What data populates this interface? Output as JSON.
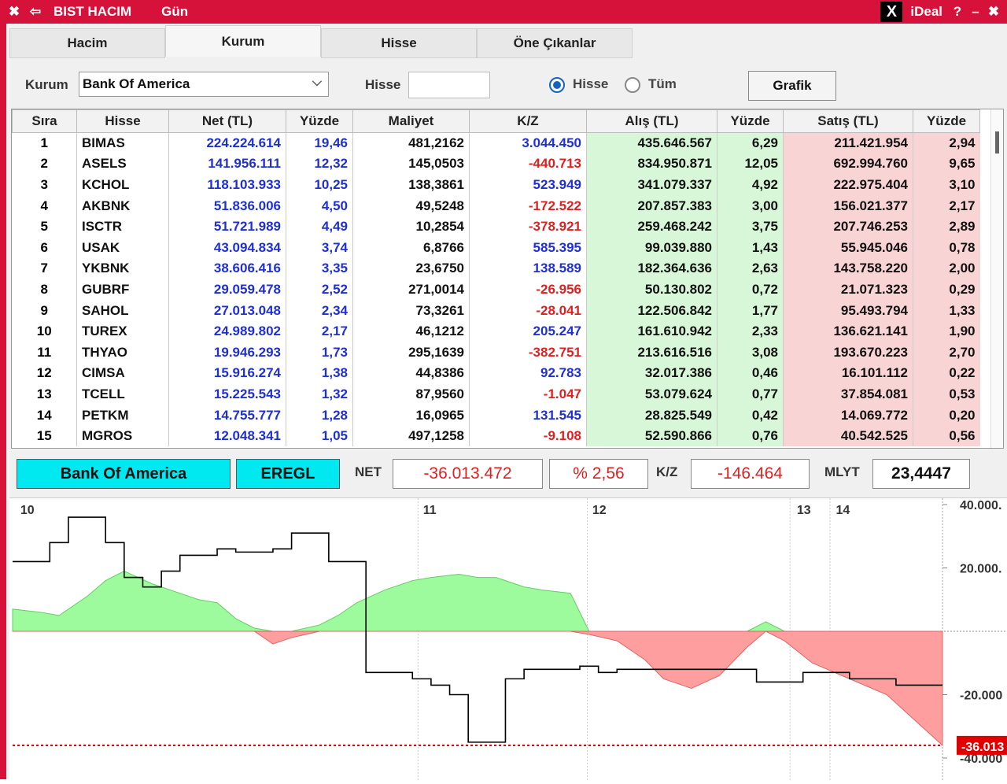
{
  "titlebar": {
    "close_symbol": "✖",
    "back_symbol": "⇦",
    "title": "BIST HACIM",
    "period": "Gün",
    "x_logo": "X",
    "brand": "iDeal",
    "help": "?",
    "minimize": "–",
    "close_right": "✖"
  },
  "tabs": [
    {
      "label": "Hacim"
    },
    {
      "label": "Kurum"
    },
    {
      "label": "Hisse"
    },
    {
      "label": "Öne Çıkanlar"
    }
  ],
  "filters": {
    "kurum_label": "Kurum",
    "kurum_value": "Bank Of America",
    "hisse_label": "Hisse",
    "hisse_value": "",
    "radio_hisse": "Hisse",
    "radio_tum": "Tüm",
    "grafik_button": "Grafik"
  },
  "table": {
    "headers": [
      "Sıra",
      "Hisse",
      "Net (TL)",
      "Yüzde",
      "Maliyet",
      "K/Z",
      "Alış (TL)",
      "Yüzde",
      "Satış (TL)",
      "Yüzde"
    ],
    "rows": [
      [
        "1",
        "BIMAS",
        "224.224.614",
        "19,46",
        "481,2162",
        "3.044.450",
        "435.646.567",
        "6,29",
        "211.421.954",
        "2,94"
      ],
      [
        "2",
        "ASELS",
        "141.956.111",
        "12,32",
        "145,0503",
        "-440.713",
        "834.950.871",
        "12,05",
        "692.994.760",
        "9,65"
      ],
      [
        "3",
        "KCHOL",
        "118.103.933",
        "10,25",
        "138,3861",
        "523.949",
        "341.079.337",
        "4,92",
        "222.975.404",
        "3,10"
      ],
      [
        "4",
        "AKBNK",
        "51.836.006",
        "4,50",
        "49,5248",
        "-172.522",
        "207.857.383",
        "3,00",
        "156.021.377",
        "2,17"
      ],
      [
        "5",
        "ISCTR",
        "51.721.989",
        "4,49",
        "10,2854",
        "-378.921",
        "259.468.242",
        "3,75",
        "207.746.253",
        "2,89"
      ],
      [
        "6",
        "USAK",
        "43.094.834",
        "3,74",
        "6,8766",
        "585.395",
        "99.039.880",
        "1,43",
        "55.945.046",
        "0,78"
      ],
      [
        "7",
        "YKBNK",
        "38.606.416",
        "3,35",
        "23,6750",
        "138.589",
        "182.364.636",
        "2,63",
        "143.758.220",
        "2,00"
      ],
      [
        "8",
        "GUBRF",
        "29.059.478",
        "2,52",
        "271,0014",
        "-26.956",
        "50.130.802",
        "0,72",
        "21.071.323",
        "0,29"
      ],
      [
        "9",
        "SAHOL",
        "27.013.048",
        "2,34",
        "73,3261",
        "-28.041",
        "122.506.842",
        "1,77",
        "95.493.794",
        "1,33"
      ],
      [
        "10",
        "TUREX",
        "24.989.802",
        "2,17",
        "46,1212",
        "205.247",
        "161.610.942",
        "2,33",
        "136.621.141",
        "1,90"
      ],
      [
        "11",
        "THYAO",
        "19.946.293",
        "1,73",
        "295,1639",
        "-382.751",
        "213.616.516",
        "3,08",
        "193.670.223",
        "2,70"
      ],
      [
        "12",
        "CIMSA",
        "15.916.274",
        "1,38",
        "44,8386",
        "92.783",
        "32.017.386",
        "0,46",
        "16.101.112",
        "0,22"
      ],
      [
        "13",
        "TCELL",
        "15.225.543",
        "1,32",
        "87,9560",
        "-1.047",
        "53.079.624",
        "0,77",
        "37.854.081",
        "0,53"
      ],
      [
        "14",
        "PETKM",
        "14.755.777",
        "1,28",
        "16,0965",
        "131.545",
        "28.825.549",
        "0,42",
        "14.069.772",
        "0,20"
      ],
      [
        "15",
        "MGROS",
        "12.048.341",
        "1,05",
        "497,1258",
        "-9.108",
        "52.590.866",
        "0,76",
        "40.542.525",
        "0,56"
      ]
    ]
  },
  "summary": {
    "kurum": "Bank Of America",
    "hisse": "EREGL",
    "net_label": "NET",
    "net_value": "-36.013.472",
    "pct_value": "% 2,56",
    "kz_label": "K/Z",
    "kz_value": "-146.464",
    "mlyt_label": "MLYT",
    "mlyt_value": "23,4447"
  },
  "chart_data": {
    "type": "area",
    "x_tick_labels": [
      "10",
      "11",
      "12",
      "13",
      "14"
    ],
    "y_tick_labels": [
      "40.000.",
      "20.000.",
      "-20.000",
      "-40.000"
    ],
    "last_value_label": "-36.013",
    "series": [
      {
        "role": "net_area",
        "x": [
          0,
          3,
          5,
          8,
          10,
          12,
          15,
          17,
          20,
          22,
          24,
          26,
          28,
          30,
          33,
          35,
          37,
          40,
          43,
          45,
          48,
          50,
          52,
          55,
          57,
          60,
          62,
          65,
          68,
          70,
          73,
          76,
          79,
          81,
          83,
          86,
          90,
          94,
          97,
          100
        ],
        "y": [
          7,
          6,
          5,
          11,
          16,
          19,
          15,
          13,
          10,
          9,
          4,
          1,
          -4,
          -2,
          2,
          5,
          9,
          13,
          16,
          17,
          18,
          17,
          17,
          14,
          13,
          12,
          -1,
          -3,
          -9,
          -15,
          -18,
          -14,
          -5,
          3,
          -3,
          -10,
          -15,
          -20,
          -28,
          -36.0
        ],
        "colors": {
          "positive": "#9dfa9d",
          "negative": "#ff9e9e"
        }
      },
      {
        "role": "cost_line",
        "x": [
          0,
          3,
          4,
          6,
          8,
          10,
          12,
          14,
          16,
          18,
          20,
          22,
          24,
          26,
          28,
          30,
          32,
          34,
          36,
          38,
          40,
          43,
          45,
          47,
          49,
          51,
          53,
          55,
          57,
          59,
          61,
          63,
          65,
          67,
          70,
          75,
          80,
          85,
          90,
          95,
          100
        ],
        "y": [
          22,
          22,
          28,
          36,
          36,
          28,
          17,
          14,
          19,
          24,
          24,
          26,
          25,
          25,
          26,
          31,
          31,
          22,
          22,
          -13,
          -13,
          -15,
          -17,
          -20,
          -35,
          -35,
          -15,
          -12,
          -12,
          -12,
          -11,
          -13,
          -12,
          -12,
          -12,
          -12,
          -16,
          -13,
          -15,
          -17,
          -17
        ],
        "color": "#000000"
      },
      {
        "role": "reference_line",
        "y_value": -36.0,
        "color": "#c00000"
      }
    ],
    "ylim": [
      -40,
      40
    ],
    "grid": true
  },
  "colors": {
    "title_bg": "#d6113a",
    "net_blue": "#1f2fd6",
    "negative_red": "#e21f1f",
    "buy_green": "#d8f7d8",
    "sell_pink": "#f9d4d4",
    "cyan": "#00e8f0"
  }
}
